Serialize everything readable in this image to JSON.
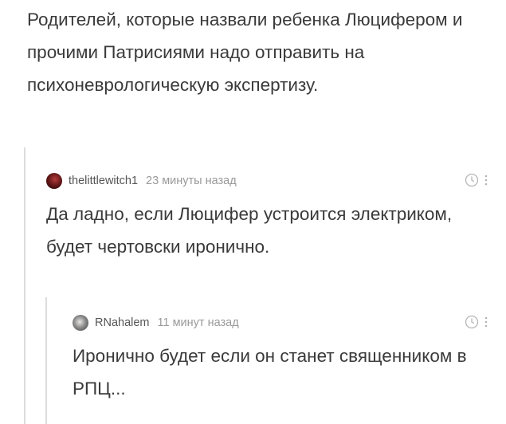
{
  "post": {
    "text": "Родителей, которые назвали ребенка Люцифером и прочими Патрисиями надо отправить на психоневрологическую экспертизу."
  },
  "comments": [
    {
      "username": "thelittlewitch1",
      "time": "23 минуты назад",
      "text": "Да ладно, если Люцифер устроится электриком, будет чертовски иронично."
    },
    {
      "username": "RNahalem",
      "time": "11 минут назад",
      "text": "Иронично будет если он станет священником в РПЦ..."
    }
  ],
  "colors": {
    "text": "#3a3a3a",
    "meta": "#9a9a9a",
    "thread_line": "#dcdcdc"
  }
}
